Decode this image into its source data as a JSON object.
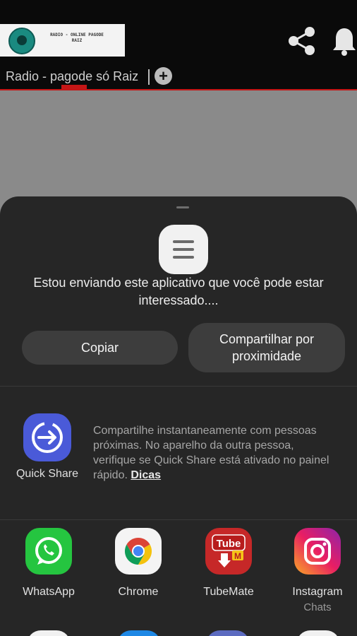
{
  "app": {
    "logo_text": "RADIO - ONLINE PAGODE RAIZ",
    "tab_label": "Radio - pagode só Raiz",
    "tab_add_symbol": "+"
  },
  "share_sheet": {
    "message": "Estou enviando este aplicativo que você pode estar interessado....",
    "copy_button": "Copiar",
    "nearby_button": "Compartilhar por proximidade",
    "quick_share": {
      "label": "Quick Share",
      "description": "Compartilhe instantaneamente com pessoas próximas. No aparelho da outra pessoa, verifique se Quick Share está ativado no painel rápido.",
      "link": "Dicas"
    },
    "apps": [
      {
        "label": "WhatsApp",
        "sub": "",
        "icon": "whatsapp-icon"
      },
      {
        "label": "Chrome",
        "sub": "",
        "icon": "chrome-icon"
      },
      {
        "label": "TubeMate",
        "sub": "",
        "icon": "tubemate-icon"
      },
      {
        "label": "Instagram",
        "sub": "Chats",
        "icon": "instagram-icon"
      }
    ]
  },
  "colors": {
    "sheet_bg": "#262626",
    "accent_red": "#c41616",
    "quick_share_blue": "#4a5ad8",
    "whatsapp_green": "#25c540"
  }
}
